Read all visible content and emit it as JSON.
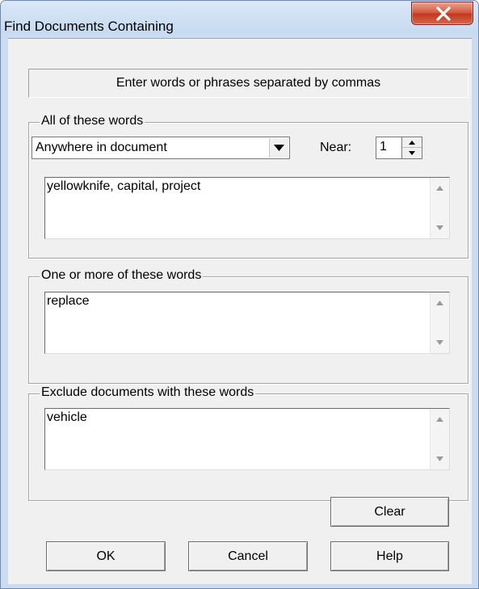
{
  "window": {
    "title": "Find Documents Containing",
    "close_icon": "close-icon"
  },
  "hint": "Enter words or phrases separated by commas",
  "all_words": {
    "group_label": "All of these words",
    "location_select": {
      "selected": "Anywhere in document",
      "icon": "chevron-down-icon"
    },
    "near_label": "Near:",
    "near_value": "1",
    "text": "yellowknife, capital, project"
  },
  "any_words": {
    "group_label": "One or more of these words",
    "text": "replace"
  },
  "exclude_words": {
    "group_label": "Exclude documents with these words",
    "text": "vehicle"
  },
  "buttons": {
    "clear": "Clear",
    "ok": "OK",
    "cancel": "Cancel",
    "help": "Help"
  },
  "colors": {
    "title_bar": "#c9dcf1",
    "close_button": "#c9432b",
    "dialog_face": "#f0f0f0"
  }
}
